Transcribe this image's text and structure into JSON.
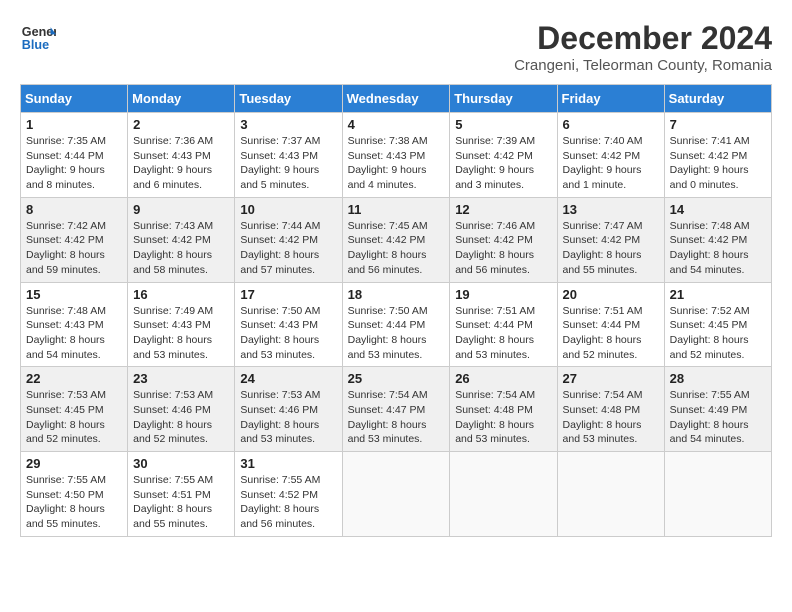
{
  "header": {
    "logo_line1": "General",
    "logo_line2": "Blue",
    "month": "December 2024",
    "location": "Crangeni, Teleorman County, Romania"
  },
  "days_of_week": [
    "Sunday",
    "Monday",
    "Tuesday",
    "Wednesday",
    "Thursday",
    "Friday",
    "Saturday"
  ],
  "weeks": [
    [
      {
        "day": 1,
        "info": "Sunrise: 7:35 AM\nSunset: 4:44 PM\nDaylight: 9 hours\nand 8 minutes."
      },
      {
        "day": 2,
        "info": "Sunrise: 7:36 AM\nSunset: 4:43 PM\nDaylight: 9 hours\nand 6 minutes."
      },
      {
        "day": 3,
        "info": "Sunrise: 7:37 AM\nSunset: 4:43 PM\nDaylight: 9 hours\nand 5 minutes."
      },
      {
        "day": 4,
        "info": "Sunrise: 7:38 AM\nSunset: 4:43 PM\nDaylight: 9 hours\nand 4 minutes."
      },
      {
        "day": 5,
        "info": "Sunrise: 7:39 AM\nSunset: 4:42 PM\nDaylight: 9 hours\nand 3 minutes."
      },
      {
        "day": 6,
        "info": "Sunrise: 7:40 AM\nSunset: 4:42 PM\nDaylight: 9 hours\nand 1 minute."
      },
      {
        "day": 7,
        "info": "Sunrise: 7:41 AM\nSunset: 4:42 PM\nDaylight: 9 hours\nand 0 minutes."
      }
    ],
    [
      {
        "day": 8,
        "info": "Sunrise: 7:42 AM\nSunset: 4:42 PM\nDaylight: 8 hours\nand 59 minutes."
      },
      {
        "day": 9,
        "info": "Sunrise: 7:43 AM\nSunset: 4:42 PM\nDaylight: 8 hours\nand 58 minutes."
      },
      {
        "day": 10,
        "info": "Sunrise: 7:44 AM\nSunset: 4:42 PM\nDaylight: 8 hours\nand 57 minutes."
      },
      {
        "day": 11,
        "info": "Sunrise: 7:45 AM\nSunset: 4:42 PM\nDaylight: 8 hours\nand 56 minutes."
      },
      {
        "day": 12,
        "info": "Sunrise: 7:46 AM\nSunset: 4:42 PM\nDaylight: 8 hours\nand 56 minutes."
      },
      {
        "day": 13,
        "info": "Sunrise: 7:47 AM\nSunset: 4:42 PM\nDaylight: 8 hours\nand 55 minutes."
      },
      {
        "day": 14,
        "info": "Sunrise: 7:48 AM\nSunset: 4:42 PM\nDaylight: 8 hours\nand 54 minutes."
      }
    ],
    [
      {
        "day": 15,
        "info": "Sunrise: 7:48 AM\nSunset: 4:43 PM\nDaylight: 8 hours\nand 54 minutes."
      },
      {
        "day": 16,
        "info": "Sunrise: 7:49 AM\nSunset: 4:43 PM\nDaylight: 8 hours\nand 53 minutes."
      },
      {
        "day": 17,
        "info": "Sunrise: 7:50 AM\nSunset: 4:43 PM\nDaylight: 8 hours\nand 53 minutes."
      },
      {
        "day": 18,
        "info": "Sunrise: 7:50 AM\nSunset: 4:44 PM\nDaylight: 8 hours\nand 53 minutes."
      },
      {
        "day": 19,
        "info": "Sunrise: 7:51 AM\nSunset: 4:44 PM\nDaylight: 8 hours\nand 53 minutes."
      },
      {
        "day": 20,
        "info": "Sunrise: 7:51 AM\nSunset: 4:44 PM\nDaylight: 8 hours\nand 52 minutes."
      },
      {
        "day": 21,
        "info": "Sunrise: 7:52 AM\nSunset: 4:45 PM\nDaylight: 8 hours\nand 52 minutes."
      }
    ],
    [
      {
        "day": 22,
        "info": "Sunrise: 7:53 AM\nSunset: 4:45 PM\nDaylight: 8 hours\nand 52 minutes."
      },
      {
        "day": 23,
        "info": "Sunrise: 7:53 AM\nSunset: 4:46 PM\nDaylight: 8 hours\nand 52 minutes."
      },
      {
        "day": 24,
        "info": "Sunrise: 7:53 AM\nSunset: 4:46 PM\nDaylight: 8 hours\nand 53 minutes."
      },
      {
        "day": 25,
        "info": "Sunrise: 7:54 AM\nSunset: 4:47 PM\nDaylight: 8 hours\nand 53 minutes."
      },
      {
        "day": 26,
        "info": "Sunrise: 7:54 AM\nSunset: 4:48 PM\nDaylight: 8 hours\nand 53 minutes."
      },
      {
        "day": 27,
        "info": "Sunrise: 7:54 AM\nSunset: 4:48 PM\nDaylight: 8 hours\nand 53 minutes."
      },
      {
        "day": 28,
        "info": "Sunrise: 7:55 AM\nSunset: 4:49 PM\nDaylight: 8 hours\nand 54 minutes."
      }
    ],
    [
      {
        "day": 29,
        "info": "Sunrise: 7:55 AM\nSunset: 4:50 PM\nDaylight: 8 hours\nand 55 minutes."
      },
      {
        "day": 30,
        "info": "Sunrise: 7:55 AM\nSunset: 4:51 PM\nDaylight: 8 hours\nand 55 minutes."
      },
      {
        "day": 31,
        "info": "Sunrise: 7:55 AM\nSunset: 4:52 PM\nDaylight: 8 hours\nand 56 minutes."
      },
      null,
      null,
      null,
      null
    ]
  ]
}
